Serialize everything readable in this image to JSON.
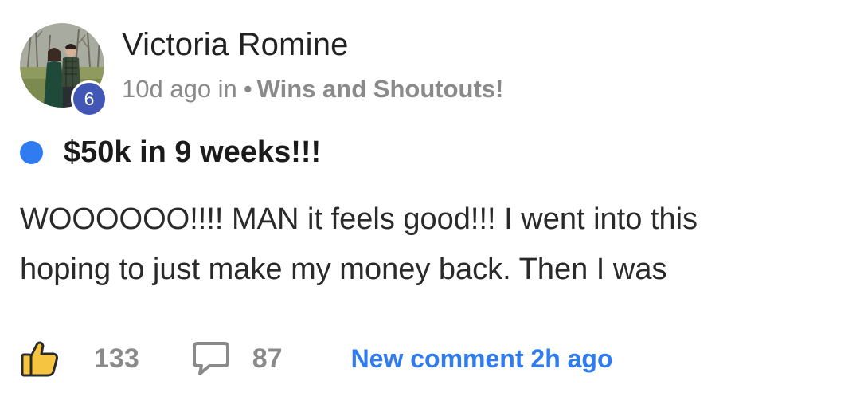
{
  "post": {
    "author": {
      "name": "Victoria Romine",
      "level": "6"
    },
    "meta": {
      "time": "10d ago in",
      "separator": "•",
      "category": "Wins and Shoutouts!"
    },
    "title": "$50k in 9 weeks!!!",
    "body_lines": [
      "WOOOOOO!!!! MAN it feels good!!! I went into this",
      "hoping to just make my money back. Then I was"
    ],
    "likes": "133",
    "comments": "87",
    "new_comment_label": "New comment 2h ago"
  },
  "colors": {
    "accent_blue": "#2f7bef",
    "level_badge": "#4257b5",
    "thumb_gold": "#f5c542",
    "muted_text": "#8a8a8a"
  },
  "icons": {
    "like": "thumbs-up-icon",
    "comment": "speech-bubble-icon",
    "unread": "unread-dot"
  }
}
